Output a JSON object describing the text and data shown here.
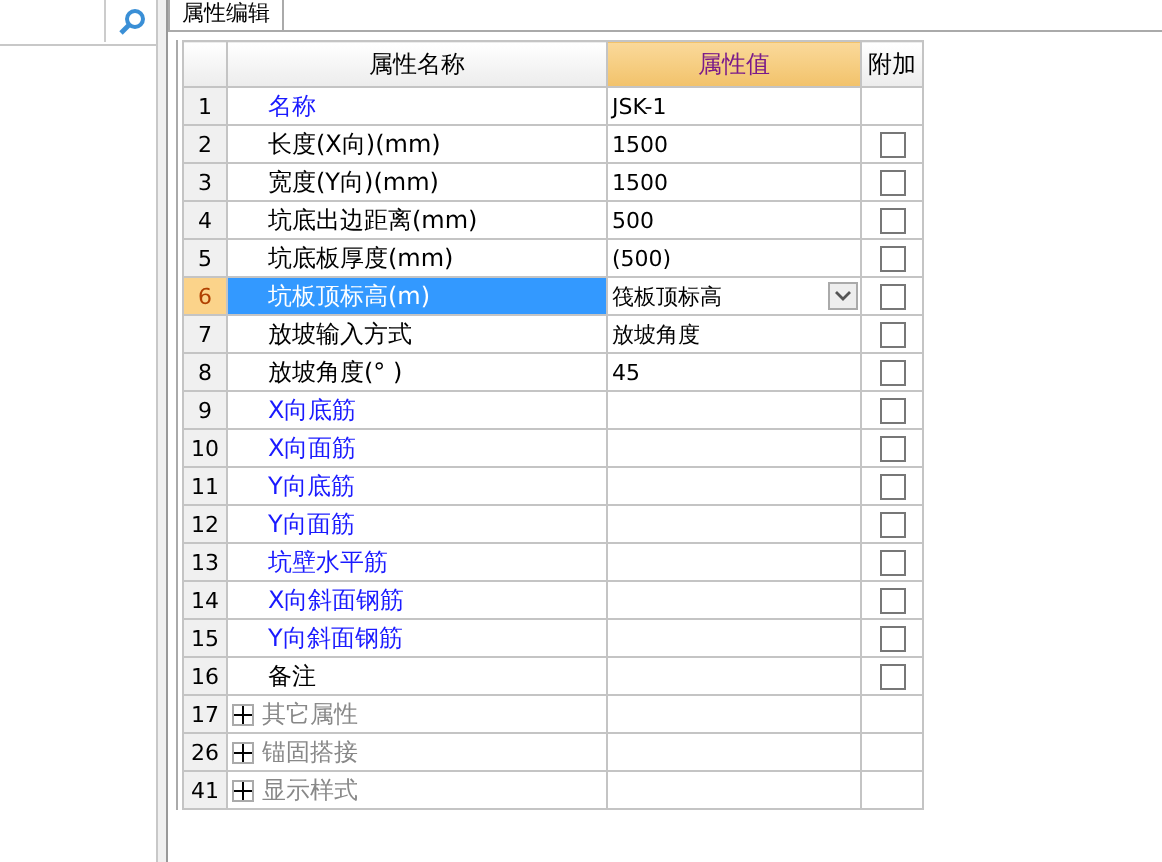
{
  "tab": {
    "label": "属性编辑"
  },
  "table": {
    "columns": [
      "属性名称",
      "属性值",
      "附加"
    ],
    "rows": [
      {
        "num": "1",
        "name": "名称",
        "value": "JSK-1",
        "kind": "public",
        "selected": false
      },
      {
        "num": "2",
        "name": "长度(X向)(mm)",
        "value": "1500",
        "kind": "private",
        "selected": false,
        "checked": false
      },
      {
        "num": "3",
        "name": "宽度(Y向)(mm)",
        "value": "1500",
        "kind": "private",
        "selected": false,
        "checked": false
      },
      {
        "num": "4",
        "name": "坑底出边距离(mm)",
        "value": "500",
        "kind": "private",
        "selected": false,
        "checked": false
      },
      {
        "num": "5",
        "name": "坑底板厚度(mm)",
        "value": "(500)",
        "kind": "private",
        "selected": false,
        "checked": false
      },
      {
        "num": "6",
        "name": "坑板顶标高(m)",
        "value": "筏板顶标高",
        "kind": "private",
        "selected": true,
        "dropdown": true,
        "checked": false
      },
      {
        "num": "7",
        "name": "放坡输入方式",
        "value": "放坡角度",
        "kind": "private",
        "selected": false,
        "checked": false
      },
      {
        "num": "8",
        "name": "放坡角度(° )",
        "value": "45",
        "kind": "private",
        "selected": false,
        "checked": false
      },
      {
        "num": "9",
        "name": "X向底筋",
        "kind": "public",
        "selected": false,
        "checked": false
      },
      {
        "num": "10",
        "name": "X向面筋",
        "kind": "public",
        "selected": false,
        "checked": false
      },
      {
        "num": "11",
        "name": "Y向底筋",
        "kind": "public",
        "selected": false,
        "checked": false
      },
      {
        "num": "12",
        "name": "Y向面筋",
        "kind": "public",
        "selected": false,
        "checked": false
      },
      {
        "num": "13",
        "name": "坑壁水平筋",
        "kind": "public",
        "selected": false,
        "checked": false
      },
      {
        "num": "14",
        "name": "X向斜面钢筋",
        "kind": "public",
        "selected": false,
        "checked": false
      },
      {
        "num": "15",
        "name": "Y向斜面钢筋",
        "kind": "public",
        "selected": false,
        "checked": false
      },
      {
        "num": "16",
        "name": "备注",
        "kind": "private",
        "selected": false,
        "checked": false
      },
      {
        "num": "17",
        "name": "其它属性",
        "kind": "group",
        "selected": false,
        "expanded": false
      },
      {
        "num": "26",
        "name": "锚固搭接",
        "kind": "group",
        "selected": false,
        "expanded": false
      },
      {
        "num": "41",
        "name": "显示样式",
        "kind": "group",
        "selected": false,
        "expanded": false
      }
    ]
  }
}
